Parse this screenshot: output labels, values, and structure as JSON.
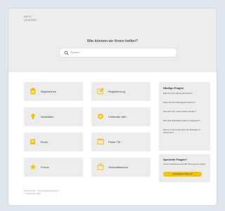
{
  "header": {
    "logo_line1": "INFO",
    "logo_line2": "CENTER",
    "question": "Wie können wir Ihnen helfen?"
  },
  "search": {
    "placeholder": "Suchen"
  },
  "categories": [
    {
      "label": "Allgemeines",
      "icon": "clipboard-icon"
    },
    {
      "label": "Registrierung",
      "icon": "edit-icon"
    },
    {
      "label": "Aktivitäten",
      "icon": "bulb-icon"
    },
    {
      "label": "Celebrate with",
      "icon": "sun-icon"
    },
    {
      "label": "Boxlo",
      "icon": "document-icon"
    },
    {
      "label": "Paste TM",
      "icon": "window-icon"
    },
    {
      "label": "Promo",
      "icon": "star-icon"
    },
    {
      "label": "Geschäftskonto",
      "icon": "bag-icon"
    }
  ],
  "faq": {
    "title": "Häufige Fragen",
    "items": [
      "Was ist mein Infocenter-Konto?",
      "Kann ich die Zahlungsart ändern?",
      "Wie kann ich meine Daten ändern?",
      "Wie viele Aktivitäten gibt es insgesamt?",
      "Gibt es noch mehr Ideen für Beiträge im Infocenter?"
    ]
  },
  "contact": {
    "title": "Spezielle Fragen?",
    "text": "Unser Kundenservice hilft Ihnen gerne weiter.",
    "cta": "Kontaktieren Sie uns"
  },
  "footer": {
    "line1": "Datenschutz · Nutzungsbedingungen",
    "line2": "© Infocenter 2024"
  },
  "colors": {
    "accent": "#f4c300",
    "tile_bg": "#ececec",
    "page_bg": "#dfe6ee"
  }
}
